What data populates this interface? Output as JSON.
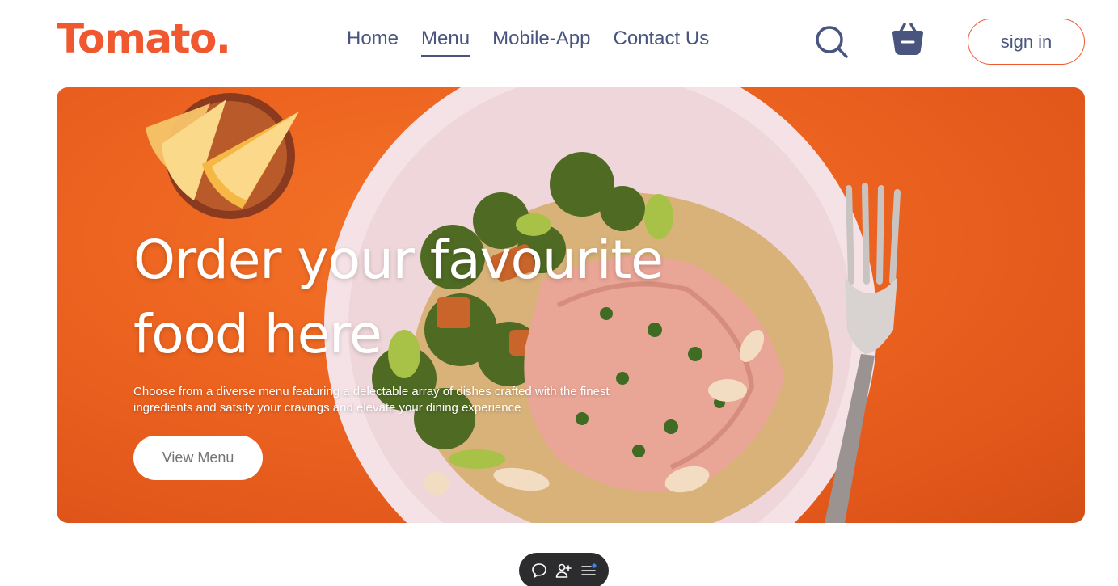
{
  "navbar": {
    "logo": "Tomato.",
    "links": [
      {
        "label": "Home",
        "active": false
      },
      {
        "label": "Menu",
        "active": true
      },
      {
        "label": "Mobile-App",
        "active": false
      },
      {
        "label": "Contact Us",
        "active": false
      }
    ],
    "icons": [
      "search-icon",
      "basket-icon"
    ],
    "signin_label": "sign in"
  },
  "hero": {
    "title": "Order your favourite food here",
    "description": "Choose from a diverse menu featuring a delectable array of dishes crafted with the finest ingredients and satsify your cravings and elevate your dining experience",
    "button_label": "View Menu"
  },
  "floating_toolbar": {
    "icons": [
      "chat-bubble-icon",
      "add-user-icon",
      "list-notification-icon"
    ]
  },
  "colors": {
    "brand": "#f0582f",
    "nav_text": "#49557e",
    "hero_bg": "#ec6320",
    "toolbar_bg": "#2c2c2e"
  }
}
